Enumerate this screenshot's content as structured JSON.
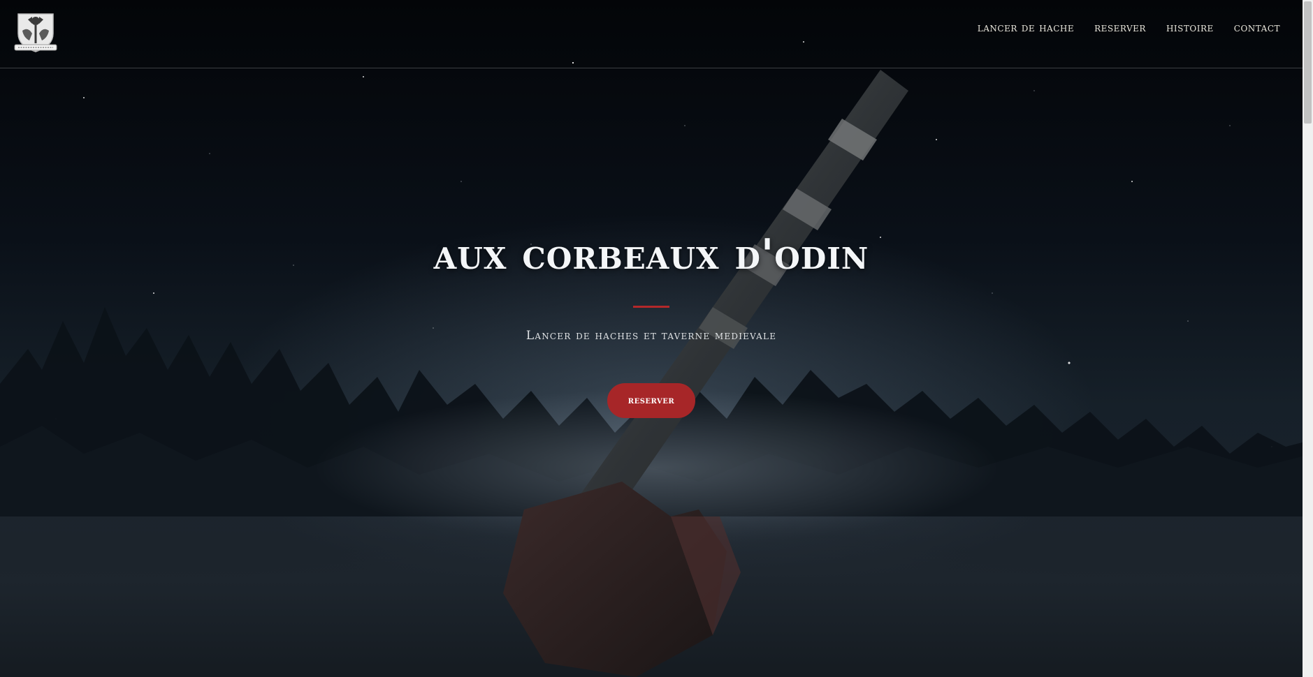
{
  "brand": {
    "logo_icon": "viking-crest-icon"
  },
  "nav": {
    "items": [
      {
        "label": "LANCER DE HACHE"
      },
      {
        "label": "RESERVER"
      },
      {
        "label": "HISTOIRE"
      },
      {
        "label": "CONTACT"
      }
    ]
  },
  "hero": {
    "title": "AUX CORBEAUX D'ODIN",
    "subtitle": "Lancer de haches et taverne medievale",
    "button_label": "RESERVER",
    "accent_color": "#a72628",
    "background_image": "axe-in-snowy-forest-night"
  }
}
